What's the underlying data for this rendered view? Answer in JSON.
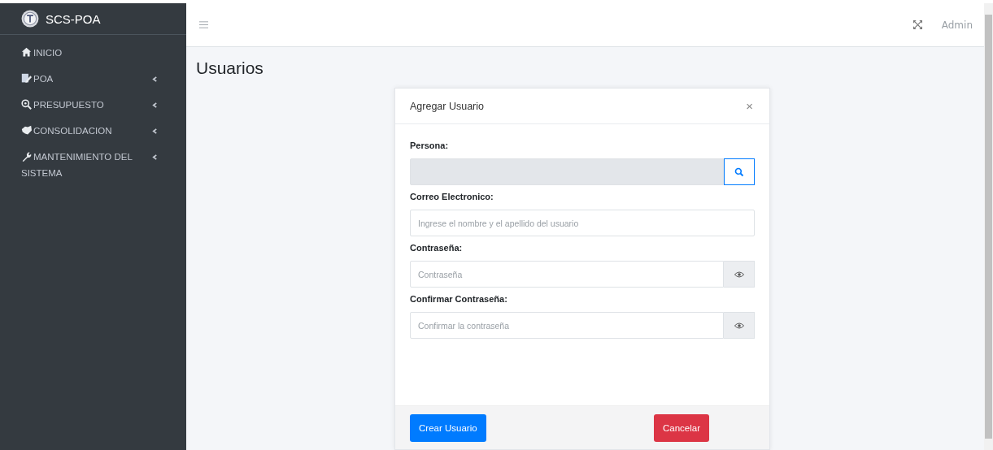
{
  "brand": {
    "title": "SCS-POA"
  },
  "sidebar": {
    "items": [
      {
        "label": "INICIO",
        "kind": "link"
      },
      {
        "label": "POA",
        "kind": "menu",
        "expanded": false
      },
      {
        "label": "PRESUPUESTO",
        "kind": "menu",
        "expanded": false
      },
      {
        "label": "CONSOLIDACION",
        "kind": "menu",
        "expanded": false
      },
      {
        "label": "MANTENIMIENTO DEL SISTEMA",
        "kind": "menu",
        "expanded": false
      }
    ]
  },
  "navbar": {
    "user": "Admin"
  },
  "page": {
    "title": "Usuarios"
  },
  "modal": {
    "title": "Agregar Usuario",
    "close": "×",
    "fields": [
      {
        "label": "Persona:",
        "kind": "search",
        "disabled": true
      },
      {
        "label": "Correo Electronico:",
        "kind": "text",
        "placeholder": "Ingrese el nombre y el apellido del usuario"
      },
      {
        "label": "Contraseña:",
        "kind": "password",
        "placeholder": "Contraseña"
      },
      {
        "label": "Confirmar Contraseña:",
        "kind": "password",
        "placeholder": "Confirmar la contraseña"
      }
    ],
    "buttons": [
      {
        "label": "Crear Usuario",
        "kind": "primary"
      },
      {
        "label": "Cancelar",
        "kind": "danger"
      }
    ]
  }
}
